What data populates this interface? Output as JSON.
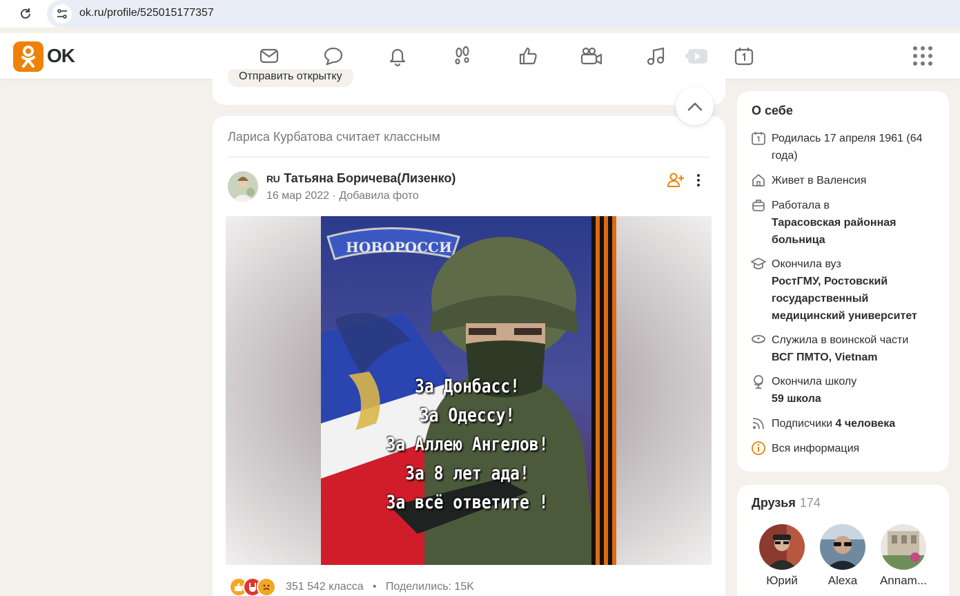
{
  "browser": {
    "url": "ok.ru/profile/525015177357"
  },
  "header": {
    "brand": "OK",
    "nav_icons": [
      "mail-icon",
      "chat-icon",
      "bell-icon",
      "footprints-icon",
      "like-icon",
      "video-camera-icon",
      "music-icon",
      "play-icon",
      "calendar-icon"
    ],
    "accent_color": "#ee8208"
  },
  "feed": {
    "prev_post_button": "Отправить открытку",
    "post": {
      "activity": "Лариса Курбатова считает классным",
      "author_flag": "RU",
      "author_name": "Татьяна Боричева(Лизенко)",
      "date": "16 мар 2022",
      "action": "Добавила фото",
      "image_lines": [
        "За Донбасс!",
        "За Одессу!",
        "За Аллею Ангелов!",
        "За 8 лет ада!",
        "За всё ответите !"
      ],
      "image_banner": "НОВОРОССИ",
      "likes": "351 542 класса",
      "shares": "Поделились: 15K"
    }
  },
  "about": {
    "title": "О себе",
    "birth": "Родилась 17 апреля 1961 (64 года)",
    "lives": "Живет в Валенсия",
    "work_label": "Работала в",
    "work_place": "Тарасовская районная больница",
    "uni_label": "Окончила вуз",
    "uni_name": "РостГМУ, Ростовский государственный медицинский университет",
    "army_label": "Служила в воинской части",
    "army_name": "ВСГ ПМТО, Vietnam",
    "school_label": "Окончила школу",
    "school_name": "59 школа",
    "subs_label": "Подписчики",
    "subs_value": "4 человека",
    "all_info": "Вся информация"
  },
  "friends": {
    "title": "Друзья",
    "count": "174",
    "list": [
      {
        "name": "Юрий"
      },
      {
        "name": "Alexa"
      },
      {
        "name": "Annam..."
      }
    ]
  }
}
